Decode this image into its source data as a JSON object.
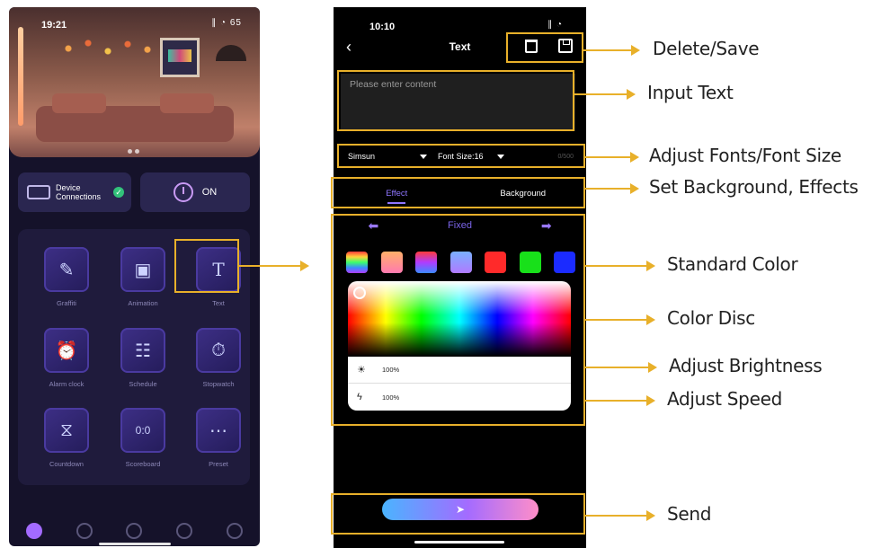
{
  "left_phone": {
    "status_time": "19:21",
    "status_icons": "∥ ◔ 65",
    "device_connections": "Device Connections",
    "power_label": "ON",
    "tiles": [
      {
        "label": "Graffiti",
        "icon": "graffiti-icon",
        "glyph": "✎"
      },
      {
        "label": "Animation",
        "icon": "animation-icon",
        "glyph": "▣"
      },
      {
        "label": "Text",
        "icon": "text-icon",
        "glyph": "T"
      },
      {
        "label": "Alarm clock",
        "icon": "alarm-clock-icon",
        "glyph": "⏰"
      },
      {
        "label": "Schedule",
        "icon": "schedule-icon",
        "glyph": "☷"
      },
      {
        "label": "Stopwatch",
        "icon": "stopwatch-icon",
        "glyph": "⏱"
      },
      {
        "label": "Countdown",
        "icon": "hourglass-icon",
        "glyph": "⧖"
      },
      {
        "label": "Scoreboard",
        "icon": "scoreboard-icon",
        "glyph": "0:0"
      },
      {
        "label": "Preset",
        "icon": "preset-icon",
        "glyph": "⋯"
      }
    ],
    "nav_icons": [
      "compass-icon",
      "settings-gear-icon",
      "cloud-icon",
      "music-icon",
      "gear-icon"
    ]
  },
  "right_phone": {
    "status_time": "10:10",
    "status_icons": "∥ ◔ ",
    "title": "Text",
    "input_placeholder": "Please enter content",
    "font_name": "Simsun",
    "font_size": "Font Size:16",
    "char_count": "0/500",
    "tabs": {
      "effect": "Effect",
      "background": "Background"
    },
    "effect_mode": "Fixed",
    "swatches": [
      "linear-gradient(180deg,#ff3b3b,#ffd43b,#3bff6b,#3b8bff,#b03bff)",
      "linear-gradient(180deg,#ffb06a,#ff7ab0)",
      "linear-gradient(180deg,#ff3b3b,#b03bff,#3b8bff)",
      "linear-gradient(180deg,#7ab0ff,#b07aff)",
      "#ff2a2a",
      "#18e01a",
      "#1b2bff"
    ],
    "brightness": "100%",
    "speed": "100%"
  },
  "callouts": {
    "delete_save": "Delete/Save",
    "input_text": "Input Text",
    "adjust_fonts": "Adjust Fonts/Font Size",
    "set_background": "Set Background, Effects",
    "standard_color": "Standard Color",
    "color_disc": "Color Disc",
    "adjust_brightness": "Adjust Brightness",
    "adjust_speed": "Adjust Speed",
    "send": "Send"
  },
  "colors": {
    "highlight": "#e8b02a",
    "accent": "#8f76ff"
  }
}
